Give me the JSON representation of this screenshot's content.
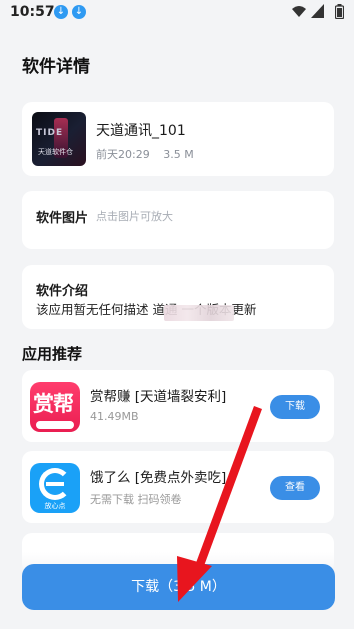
{
  "status_bar": {
    "time": "10:57",
    "download_badges": [
      "↓",
      "↓"
    ],
    "icons": [
      "wifi-icon",
      "signal-icon",
      "battery-icon"
    ]
  },
  "page": {
    "title": "软件详情"
  },
  "app": {
    "name": "天道通讯_101",
    "date": "前天20:29",
    "size": "3.5 M",
    "icon_title": "TIDE",
    "icon_caption": "天道软件仓"
  },
  "pictures": {
    "title": "软件图片",
    "hint": "点击图片可放大"
  },
  "intro": {
    "title": "软件介绍",
    "text": "该应用暂无任何描述 道通   一个版本更新"
  },
  "recommend": {
    "title": "应用推荐",
    "items": [
      {
        "name": "赏帮赚 [天道墙裂安利]",
        "sub": "41.49MB",
        "button": "下载",
        "icon_text": "赏帮"
      },
      {
        "name": "饿了么 [免费点外卖吃]",
        "sub": "无需下载 扫码领卷",
        "button": "查看",
        "icon_text": "放心点"
      }
    ]
  },
  "download_button": "下载（3.5 M）",
  "colors": {
    "accent": "#3a8ee6",
    "annotation_arrow": "#e8151e"
  }
}
